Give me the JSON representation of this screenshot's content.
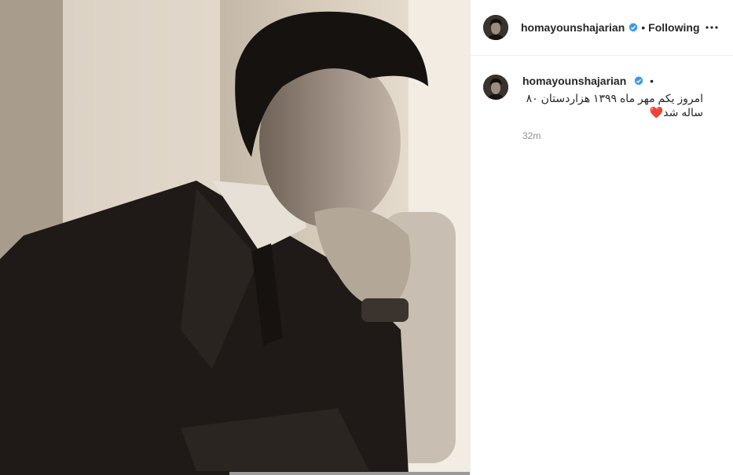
{
  "post": {
    "photo_alt": "",
    "icon": "photo"
  },
  "header": {
    "username": "homayounshajarian",
    "separator": "•",
    "follow_label": "Following",
    "verified_icon": "verified-badge-icon",
    "more_icon": "more-options-icon"
  },
  "comment": {
    "username": "homayounshajarian",
    "separator": "•",
    "caption_line1": "امروز یکم مهر ماه ۱۳۹۹ هزاردستان ۸۰",
    "caption_line2": "ساله شد",
    "heart": "❤️",
    "time": "32m"
  },
  "colors": {
    "verified": "#3897f0",
    "text": "#262626",
    "muted": "#8e8e8e"
  }
}
